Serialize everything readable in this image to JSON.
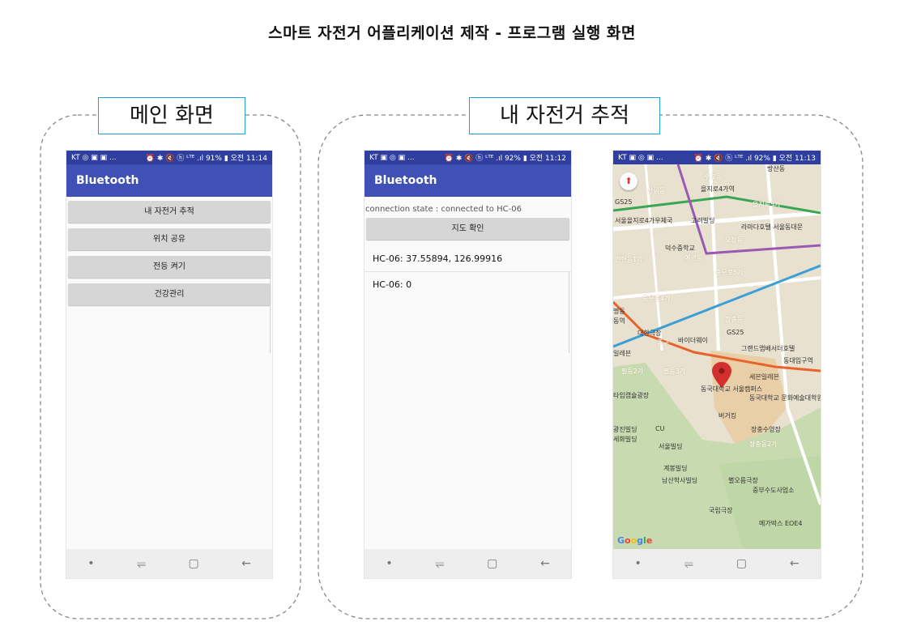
{
  "page": {
    "title": "스마트 자전거 어플리케이션 제작 - 프로그램 실행 화면",
    "group_main_label": "메인 화면",
    "group_tracking_label": "내 자전거 추적"
  },
  "phone_main": {
    "status_left": "KT ◎ ▣ ▣ ...",
    "status_right": "⏰ ✱ 🔇 ⓗ ᴸᵀᴱ .ıl 91% ▮ 오전 11:14",
    "app_title": "Bluetooth",
    "menu": [
      {
        "label": "내 자전거 추적"
      },
      {
        "label": "위치 공유"
      },
      {
        "label": "전등 켜기"
      },
      {
        "label": "건강관리"
      }
    ]
  },
  "phone_bt": {
    "status_left": "KT ▣ ◎ ▣ ...",
    "status_right": "⏰ ✱ 🔇 ⓗ ᴸᵀᴱ .ıl 92% ▮ 오전 11:12",
    "app_title": "Bluetooth",
    "connection_state": "connection state : connected to HC-06",
    "map_button": "지도 확인",
    "messages": [
      {
        "text": "HC-06: 37.55894, 126.99916"
      },
      {
        "text": "HC-06: 0"
      }
    ]
  },
  "phone_map": {
    "status_left": "KT ▣ ◎ ▣ ...",
    "status_right": "⏰ ✱ 🔇 ⓗ ᴸᵀᴱ .ıl 92% ▮ 오전 11:13",
    "labels": [
      {
        "text": "방산동"
      },
      {
        "text": "주교동"
      },
      {
        "text": "을지로4가역"
      },
      {
        "text": "산림동"
      },
      {
        "text": "GS25"
      },
      {
        "text": "을지로5가"
      },
      {
        "text": "서울을지로4가우체국"
      },
      {
        "text": "고려빌딩"
      },
      {
        "text": "라마다호텔 서울동대문"
      },
      {
        "text": "덕수중학교"
      },
      {
        "text": "오장동"
      },
      {
        "text": "인현동1가"
      },
      {
        "text": "예관동"
      },
      {
        "text": "충무로5가"
      },
      {
        "text": "충무로4가"
      },
      {
        "text": "대한극장"
      },
      {
        "text": "바이더웨이"
      },
      {
        "text": "GS25"
      },
      {
        "text": "중구"
      },
      {
        "text": "그랜드앰배서더호텔"
      },
      {
        "text": "동대입구역"
      },
      {
        "text": "필동2가"
      },
      {
        "text": "필동3가"
      },
      {
        "text": "세븐일레븐"
      },
      {
        "text": "동국대학교 서울캠퍼스"
      },
      {
        "text": "동국대학교 문화예술대학원"
      },
      {
        "text": "타임캡슐광장"
      },
      {
        "text": "버거킹"
      },
      {
        "text": "장충수영장"
      },
      {
        "text": "광진빌딩"
      },
      {
        "text": "CU"
      },
      {
        "text": "세화빌딩"
      },
      {
        "text": "장충동2가"
      },
      {
        "text": "서울빌딩"
      },
      {
        "text": "계봉빌딩"
      },
      {
        "text": "남산학사빌딩"
      },
      {
        "text": "별오름극장"
      },
      {
        "text": "중부수도사업소"
      },
      {
        "text": "국립극장"
      },
      {
        "text": "메가박스 EOE4"
      },
      {
        "text": "동역"
      },
      {
        "text": "일레븐"
      },
      {
        "text": "명동"
      },
      {
        "text": "장충동"
      }
    ],
    "google_logo": [
      "G",
      "o",
      "o",
      "g",
      "l",
      "e"
    ]
  },
  "colors": {
    "app_bar": "#3f51b5",
    "status_bar": "#303f9f",
    "frame_label_border": "#1ea0d8",
    "map_pin": "#d32f2f",
    "subway_green": "#3aa655",
    "subway_blue": "#3a9fd6",
    "subway_purple": "#9b59b6",
    "subway_orange": "#e8632a"
  },
  "icons": {
    "nav_dot": "•",
    "nav_recent": "⥫",
    "nav_home": "▢",
    "nav_back": "←",
    "compass": "⬆"
  }
}
